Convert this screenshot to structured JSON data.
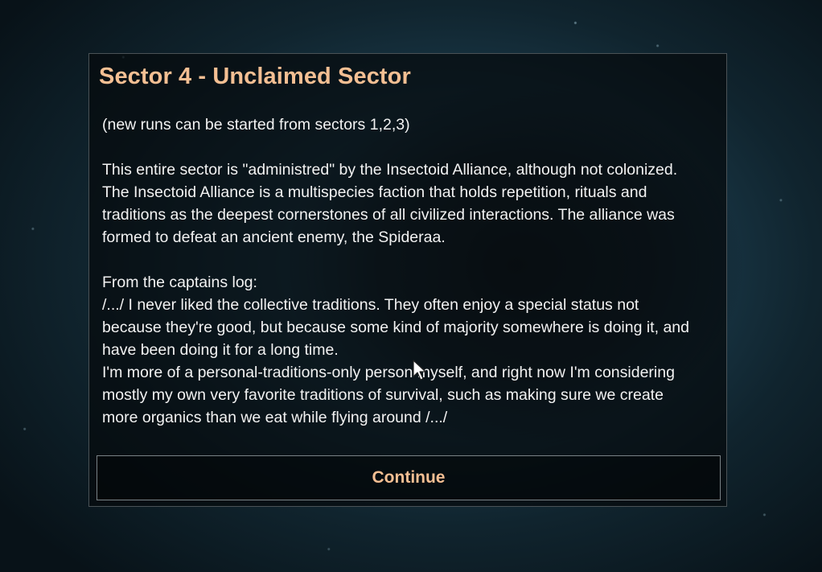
{
  "dialog": {
    "title": "Sector 4 - Unclaimed Sector",
    "note": "(new runs can be started from sectors 1,2,3)",
    "description_lines": [
      "This entire sector is \"administred\" by the Insectoid Alliance, although not colonized.",
      "The Insectoid Alliance is a multispecies faction that holds repetition, rituals and",
      "traditions as the deepest cornerstones of all civilized interactions. The alliance was",
      "formed to defeat an ancient enemy, the Spideraa."
    ],
    "log_heading": "From the captains log:",
    "log_lines": [
      "/.../ I never liked the collective traditions. They often enjoy a special status not",
      "because they're good, but because some kind of majority somewhere is doing it, and",
      "have been doing it for a long time.",
      "I'm more of a personal-traditions-only person myself, and right now I'm considering",
      "mostly my own very favorite traditions of survival, such as making sure we create",
      "more organics than we eat while flying around /.../"
    ],
    "continue_label": "Continue"
  },
  "colors": {
    "title": "#f4bf93",
    "body_text": "#f2f2f2",
    "panel_border": "#4a5256"
  }
}
